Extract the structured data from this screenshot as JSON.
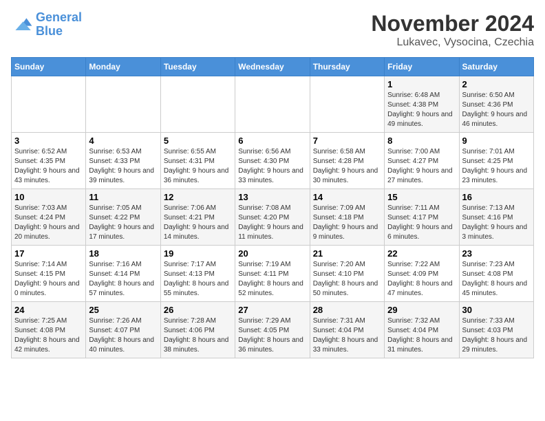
{
  "logo": {
    "line1": "General",
    "line2": "Blue"
  },
  "title": "November 2024",
  "subtitle": "Lukavec, Vysocina, Czechia",
  "days_of_week": [
    "Sunday",
    "Monday",
    "Tuesday",
    "Wednesday",
    "Thursday",
    "Friday",
    "Saturday"
  ],
  "weeks": [
    [
      {
        "day": "",
        "info": ""
      },
      {
        "day": "",
        "info": ""
      },
      {
        "day": "",
        "info": ""
      },
      {
        "day": "",
        "info": ""
      },
      {
        "day": "",
        "info": ""
      },
      {
        "day": "1",
        "info": "Sunrise: 6:48 AM\nSunset: 4:38 PM\nDaylight: 9 hours and 49 minutes."
      },
      {
        "day": "2",
        "info": "Sunrise: 6:50 AM\nSunset: 4:36 PM\nDaylight: 9 hours and 46 minutes."
      }
    ],
    [
      {
        "day": "3",
        "info": "Sunrise: 6:52 AM\nSunset: 4:35 PM\nDaylight: 9 hours and 43 minutes."
      },
      {
        "day": "4",
        "info": "Sunrise: 6:53 AM\nSunset: 4:33 PM\nDaylight: 9 hours and 39 minutes."
      },
      {
        "day": "5",
        "info": "Sunrise: 6:55 AM\nSunset: 4:31 PM\nDaylight: 9 hours and 36 minutes."
      },
      {
        "day": "6",
        "info": "Sunrise: 6:56 AM\nSunset: 4:30 PM\nDaylight: 9 hours and 33 minutes."
      },
      {
        "day": "7",
        "info": "Sunrise: 6:58 AM\nSunset: 4:28 PM\nDaylight: 9 hours and 30 minutes."
      },
      {
        "day": "8",
        "info": "Sunrise: 7:00 AM\nSunset: 4:27 PM\nDaylight: 9 hours and 27 minutes."
      },
      {
        "day": "9",
        "info": "Sunrise: 7:01 AM\nSunset: 4:25 PM\nDaylight: 9 hours and 23 minutes."
      }
    ],
    [
      {
        "day": "10",
        "info": "Sunrise: 7:03 AM\nSunset: 4:24 PM\nDaylight: 9 hours and 20 minutes."
      },
      {
        "day": "11",
        "info": "Sunrise: 7:05 AM\nSunset: 4:22 PM\nDaylight: 9 hours and 17 minutes."
      },
      {
        "day": "12",
        "info": "Sunrise: 7:06 AM\nSunset: 4:21 PM\nDaylight: 9 hours and 14 minutes."
      },
      {
        "day": "13",
        "info": "Sunrise: 7:08 AM\nSunset: 4:20 PM\nDaylight: 9 hours and 11 minutes."
      },
      {
        "day": "14",
        "info": "Sunrise: 7:09 AM\nSunset: 4:18 PM\nDaylight: 9 hours and 9 minutes."
      },
      {
        "day": "15",
        "info": "Sunrise: 7:11 AM\nSunset: 4:17 PM\nDaylight: 9 hours and 6 minutes."
      },
      {
        "day": "16",
        "info": "Sunrise: 7:13 AM\nSunset: 4:16 PM\nDaylight: 9 hours and 3 minutes."
      }
    ],
    [
      {
        "day": "17",
        "info": "Sunrise: 7:14 AM\nSunset: 4:15 PM\nDaylight: 9 hours and 0 minutes."
      },
      {
        "day": "18",
        "info": "Sunrise: 7:16 AM\nSunset: 4:14 PM\nDaylight: 8 hours and 57 minutes."
      },
      {
        "day": "19",
        "info": "Sunrise: 7:17 AM\nSunset: 4:13 PM\nDaylight: 8 hours and 55 minutes."
      },
      {
        "day": "20",
        "info": "Sunrise: 7:19 AM\nSunset: 4:11 PM\nDaylight: 8 hours and 52 minutes."
      },
      {
        "day": "21",
        "info": "Sunrise: 7:20 AM\nSunset: 4:10 PM\nDaylight: 8 hours and 50 minutes."
      },
      {
        "day": "22",
        "info": "Sunrise: 7:22 AM\nSunset: 4:09 PM\nDaylight: 8 hours and 47 minutes."
      },
      {
        "day": "23",
        "info": "Sunrise: 7:23 AM\nSunset: 4:08 PM\nDaylight: 8 hours and 45 minutes."
      }
    ],
    [
      {
        "day": "24",
        "info": "Sunrise: 7:25 AM\nSunset: 4:08 PM\nDaylight: 8 hours and 42 minutes."
      },
      {
        "day": "25",
        "info": "Sunrise: 7:26 AM\nSunset: 4:07 PM\nDaylight: 8 hours and 40 minutes."
      },
      {
        "day": "26",
        "info": "Sunrise: 7:28 AM\nSunset: 4:06 PM\nDaylight: 8 hours and 38 minutes."
      },
      {
        "day": "27",
        "info": "Sunrise: 7:29 AM\nSunset: 4:05 PM\nDaylight: 8 hours and 36 minutes."
      },
      {
        "day": "28",
        "info": "Sunrise: 7:31 AM\nSunset: 4:04 PM\nDaylight: 8 hours and 33 minutes."
      },
      {
        "day": "29",
        "info": "Sunrise: 7:32 AM\nSunset: 4:04 PM\nDaylight: 8 hours and 31 minutes."
      },
      {
        "day": "30",
        "info": "Sunrise: 7:33 AM\nSunset: 4:03 PM\nDaylight: 8 hours and 29 minutes."
      }
    ]
  ]
}
